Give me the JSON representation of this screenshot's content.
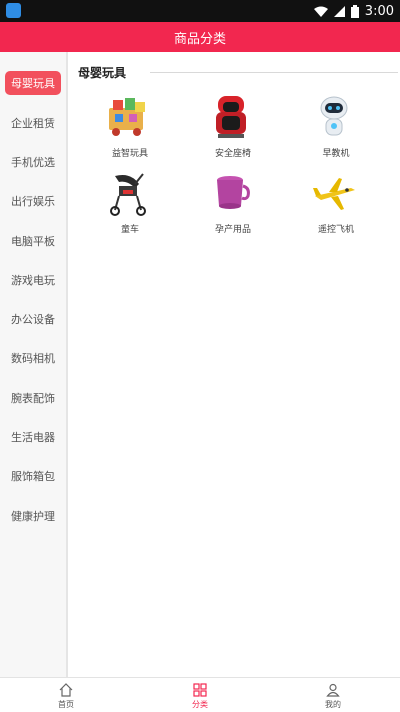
{
  "status_bar": {
    "time": "3:00"
  },
  "header": {
    "title": "商品分类"
  },
  "sidebar": {
    "items": [
      {
        "label": "母婴玩具",
        "active": true
      },
      {
        "label": "企业租赁"
      },
      {
        "label": "手机优选"
      },
      {
        "label": "出行娱乐"
      },
      {
        "label": "电脑平板"
      },
      {
        "label": "游戏电玩"
      },
      {
        "label": "办公设备"
      },
      {
        "label": "数码相机"
      },
      {
        "label": "腕表配饰"
      },
      {
        "label": "生活电器"
      },
      {
        "label": "服饰箱包"
      },
      {
        "label": "健康护理"
      }
    ]
  },
  "section": {
    "title": "母婴玩具",
    "products": [
      {
        "label": "益智玩具",
        "icon": "toy-blocks-icon"
      },
      {
        "label": "安全座椅",
        "icon": "car-seat-icon"
      },
      {
        "label": "早教机",
        "icon": "robot-icon"
      },
      {
        "label": "童车",
        "icon": "stroller-icon"
      },
      {
        "label": "孕产用品",
        "icon": "maternity-cup-icon"
      },
      {
        "label": "遥控飞机",
        "icon": "rc-plane-icon"
      }
    ]
  },
  "bottom_nav": {
    "tabs": [
      {
        "label": "首页",
        "icon": "home-icon"
      },
      {
        "label": "分类",
        "icon": "category-icon",
        "active": true
      },
      {
        "label": "我的",
        "icon": "user-icon"
      }
    ]
  },
  "colors": {
    "accent": "#f2274f",
    "active_pill": "#f2505d",
    "sidebar_bg": "#f7f7f7"
  }
}
